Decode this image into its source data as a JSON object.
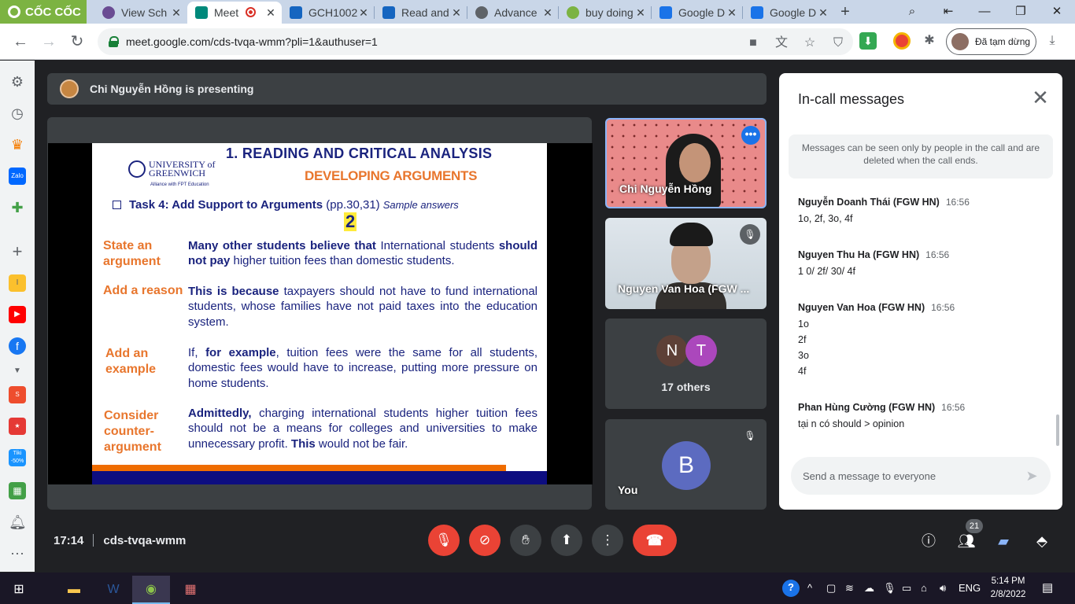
{
  "browser": {
    "brand": "CỐC CỐC",
    "tabs": [
      {
        "label": "View Sch",
        "color": "#6a4c93"
      },
      {
        "label": "Meet",
        "color": "#00897b"
      },
      {
        "label": "GCH1002",
        "color": "#1565c0"
      },
      {
        "label": "Read and",
        "color": "#1565c0"
      },
      {
        "label": "Advance",
        "color": "#5f6368"
      },
      {
        "label": "buy doing",
        "color": "#7cb342"
      },
      {
        "label": "Google D",
        "color": "#1a73e8"
      },
      {
        "label": "Google D",
        "color": "#1a73e8"
      }
    ],
    "url": "meet.google.com/cds-tvqa-wmm?pli=1&authuser=1",
    "profile_status": "Đã tạm dừng"
  },
  "meet": {
    "presenting_banner": "Chi Nguyễn Hồng is presenting",
    "slide": {
      "title": "1. READING AND CRITICAL ANALYSIS",
      "subtitle": "DEVELOPING ARGUMENTS",
      "university_line1": "UNIVERSITY of",
      "university_line2": "GREENWICH",
      "alliance": "Alliance with FPT Education",
      "task": "Task 4: Add Support to Arguments",
      "task_pages": "(pp.30,31)",
      "task_note": "Sample answers",
      "answer_number": "2",
      "rows": [
        {
          "label_lines": [
            "State an",
            "argument"
          ],
          "text_bold1": "Many other students believe that",
          "text1": " International students ",
          "text_bold2": "should not pay",
          "text2": " higher tuition fees than domestic students."
        },
        {
          "label_lines": [
            "Add a reason"
          ],
          "text_bold1": "This is because",
          "text1": " taxpayers should not have to fund international students, whose families have not paid taxes into the education system.",
          "text_bold2": "",
          "text2": ""
        },
        {
          "label_lines": [
            "Add an",
            "example"
          ],
          "text_bold1": "",
          "text1": "If, ",
          "text_bold2": "for example",
          "text2": ", tuition fees were the same for all students, domestic fees would have to increase, putting more pressure on home students."
        },
        {
          "label_lines": [
            "Consider",
            "counter-",
            "argument"
          ],
          "text_bold1": "Admittedly,",
          "text1": " charging international students higher tuition fees should not be a means for colleges and universities to make unnecessary profit. ",
          "text_bold2": "This",
          "text2": " would not be fair."
        }
      ]
    },
    "participants": {
      "presenter": "Chi Nguyễn Hồng",
      "second": "Nguyen Van Hoa (FGW ...",
      "others_initials": [
        "N",
        "T"
      ],
      "others_label": "17 others",
      "self_label": "You",
      "self_initial": "B"
    },
    "chat": {
      "title": "In-call messages",
      "notice": "Messages can be seen only by people in the call and are deleted when the call ends.",
      "messages": [
        {
          "sender": "Nguyễn Doanh Thái (FGW HN)",
          "time": "16:56",
          "lines": [
            "1o, 2f, 3o, 4f"
          ]
        },
        {
          "sender": "Nguyen Thu Ha (FGW HN)",
          "time": "16:56",
          "lines": [
            "1 0/ 2f/ 30/ 4f"
          ]
        },
        {
          "sender": "Nguyen Van Hoa (FGW HN)",
          "time": "16:56",
          "lines": [
            "1o",
            "2f",
            "3o",
            "4f"
          ]
        },
        {
          "sender": "Phan Hùng Cường (FGW HN)",
          "time": "16:56",
          "lines": [
            "tại n có should > opinion"
          ]
        }
      ],
      "input_placeholder": "Send a message to everyone"
    },
    "bottom": {
      "time": "17:14",
      "meeting_code": "cds-tvqa-wmm",
      "participant_count": "21"
    }
  },
  "taskbar": {
    "language": "ENG",
    "time": "5:14 PM",
    "date": "2/8/2022"
  },
  "colors": {
    "accent": "#1a73e8",
    "danger": "#ea4335",
    "meet_bg": "#202124",
    "slide_navy": "#1a237e",
    "slide_orange": "#e8762d"
  }
}
